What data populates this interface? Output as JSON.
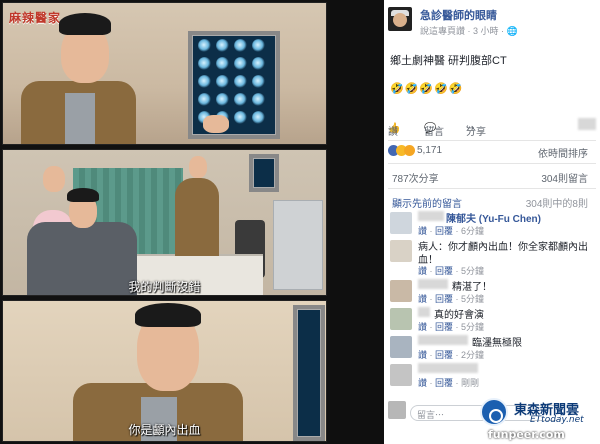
{
  "strip": {
    "watermark": "麻辣醫家",
    "caption_panel2": "我的判斷沒錯",
    "caption_panel3": "你是顱內出血"
  },
  "post": {
    "page_name": "急診醫師的眼睛",
    "page_sub": "說這專頁讚 · 3 小時 · ",
    "text": "鄉土劇神醫 研判腹部CT",
    "emojis": "🤣🤣🤣🤣🤣",
    "actions": {
      "like": "讚",
      "comment": "留言",
      "share": "分享"
    },
    "reaction_count": "5,171",
    "seen_by": "依時間排序",
    "shares": "787次分享",
    "comments_count": "304則留言",
    "view_previous": "顯示先前的留言",
    "previous_count": "304則中的8則"
  },
  "comments": [
    {
      "name": "陳郁夫 (Yu-Fu Chen)",
      "text": "",
      "meta_like": "讚",
      "meta_reply": "回覆",
      "meta_time": "6分鐘"
    },
    {
      "name": "",
      "text": "病人：你才顱內出血！你全家都顱內出",
      "text2": "血！",
      "meta_like": "讚",
      "meta_reply": "回覆",
      "meta_time": "5分鐘"
    },
    {
      "name": "",
      "text": "精湛了！",
      "meta_like": "讚",
      "meta_reply": "回覆",
      "meta_time": "5分鐘"
    },
    {
      "name": "",
      "text": "真的好會演",
      "meta_like": "讚",
      "meta_reply": "回覆",
      "meta_time": "5分鐘"
    },
    {
      "name": "",
      "text": "臨濹無極限",
      "meta_like": "讚",
      "meta_reply": "回覆",
      "meta_time": "2分鐘"
    },
    {
      "name": "",
      "text": "",
      "meta_like": "讚",
      "meta_reply": "回覆",
      "meta_time": "剛剛"
    }
  ],
  "compose_placeholder": "留言⋯",
  "branding": {
    "ettoday_name": "東森新聞雲",
    "ettoday_sub": "ETtoday.net",
    "funpeer": "funpeer.com"
  },
  "colors": {
    "link": "#365899",
    "ct_board": "#0c2e48",
    "watermark": "#c0392b"
  }
}
